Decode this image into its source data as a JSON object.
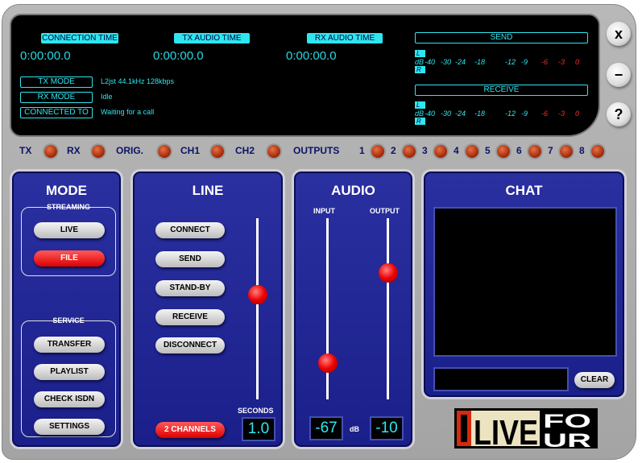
{
  "display": {
    "connection_time_label": "CONNECTION TIME",
    "tx_audio_time_label": "TX AUDIO TIME",
    "rx_audio_time_label": "RX AUDIO TIME",
    "connection_time": "0:00:00.0",
    "tx_audio_time": "0:00:00.0",
    "rx_audio_time": "0:00:00.0",
    "tx_mode_label": "TX MODE",
    "tx_mode": "L2jst 44.1kHz 128kbps",
    "rx_mode_label": "RX MODE",
    "rx_mode": "Idle",
    "connected_to_label": "CONNECTED TO",
    "connected_to": "Waiting for a call",
    "send_label": "SEND",
    "receive_label": "RECEIVE",
    "meter": {
      "l": "L",
      "r": "R",
      "db": "dB",
      "scale": [
        "-40",
        "-30",
        "-24",
        "-18",
        "-12",
        "-9",
        "-6",
        "-3",
        "0"
      ]
    }
  },
  "window_buttons": {
    "close": "x",
    "minimize": "−",
    "help": "?"
  },
  "indicators": {
    "tx": "TX",
    "rx": "RX",
    "orig": "ORIG.",
    "ch1": "CH1",
    "ch2": "CH2",
    "outputs": "OUTPUTS",
    "outputs_nums": [
      "1",
      "2",
      "3",
      "4",
      "5",
      "6",
      "7",
      "8"
    ]
  },
  "mode": {
    "title": "MODE",
    "streaming": "STREAMING",
    "live": "LIVE",
    "file": "FILE",
    "service": "SERVICE",
    "transfer": "TRANSFER",
    "playlist": "PLAYLIST",
    "check_isdn": "CHECK ISDN",
    "settings": "SETTINGS",
    "selected": "FILE"
  },
  "line": {
    "title": "LINE",
    "connect": "CONNECT",
    "send": "SEND",
    "standby": "STAND-BY",
    "receive": "RECEIVE",
    "disconnect": "DISCONNECT",
    "two_channels": "2 CHANNELS",
    "seconds_label": "SECONDS",
    "seconds": "1.0",
    "slider_level": 0.58
  },
  "audio": {
    "title": "AUDIO",
    "input_label": "INPUT",
    "output_label": "OUTPUT",
    "input_db": "-67",
    "output_db": "-10",
    "db_label": "dB",
    "input_level": 0.2,
    "output_level": 0.7
  },
  "chat": {
    "title": "CHAT",
    "input_value": "",
    "clear": "CLEAR"
  },
  "logo": {
    "text": "LIVE FOUR"
  },
  "colors": {
    "accent": "#2ee6f0",
    "panel": "#1a1f8a",
    "active": "#e00000"
  }
}
